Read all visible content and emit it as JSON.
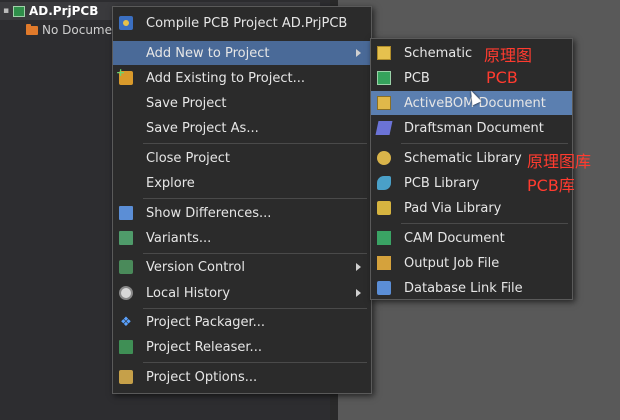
{
  "project_tree": {
    "root_label": "AD.PrjPCB",
    "child_label": "No Documen"
  },
  "main_menu": {
    "items": [
      {
        "label": "Compile PCB Project AD.PrjPCB",
        "icon": "compile-icon"
      },
      {
        "label": "Add New to Project",
        "icon": "",
        "submenu": true,
        "highlighted": true
      },
      {
        "label": "Add Existing to Project...",
        "icon": "add-existing-icon"
      },
      {
        "label": "Save Project",
        "icon": ""
      },
      {
        "label": "Save Project As...",
        "icon": ""
      },
      {
        "label": "Close Project",
        "icon": ""
      },
      {
        "label": "Explore",
        "icon": ""
      },
      {
        "label": "Show Differences...",
        "icon": "show-differences-icon"
      },
      {
        "label": "Variants...",
        "icon": "variants-icon"
      },
      {
        "label": "Version Control",
        "icon": "version-control-icon",
        "submenu": true
      },
      {
        "label": "Local History",
        "icon": "local-history-icon",
        "submenu": true
      },
      {
        "label": "Project Packager...",
        "icon": "dropbox-icon"
      },
      {
        "label": "Project Releaser...",
        "icon": "releaser-icon"
      },
      {
        "label": "Project Options...",
        "icon": "options-icon"
      }
    ]
  },
  "sub_menu": {
    "items": [
      {
        "label": "Schematic",
        "icon": "schematic-icon"
      },
      {
        "label": "PCB",
        "icon": "pcb-icon"
      },
      {
        "label": "ActiveBOM Document",
        "icon": "activebom-icon",
        "highlighted": true
      },
      {
        "label": "Draftsman Document",
        "icon": "draftsman-icon"
      },
      {
        "label": "Schematic Library",
        "icon": "schematic-library-icon"
      },
      {
        "label": "PCB Library",
        "icon": "pcb-library-icon"
      },
      {
        "label": "Pad Via Library",
        "icon": "pad-via-library-icon"
      },
      {
        "label": "CAM Document",
        "icon": "cam-document-icon"
      },
      {
        "label": "Output Job File",
        "icon": "output-job-icon"
      },
      {
        "label": "Database Link File",
        "icon": "database-link-icon"
      }
    ]
  },
  "annotations": {
    "schematic": "原理图",
    "pcb": "PCB",
    "schematic_library": "原理图库",
    "pcb_library": "PCB库"
  },
  "colors": {
    "menu_bg": "#2b2b2b",
    "highlight": "#4a6a98",
    "annotation": "#ff3b2f"
  }
}
